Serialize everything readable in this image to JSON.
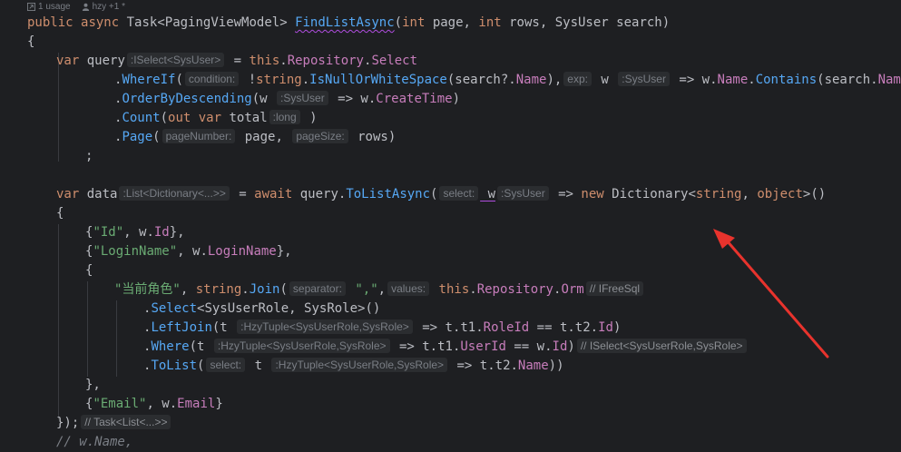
{
  "meta": {
    "usages": "1 usage",
    "author": "hzy +1 *"
  },
  "code": {
    "l01": {
      "kw1": "public",
      "kw2": "async",
      "t1": "Task",
      "t2": "<",
      "t3": "PagingViewModel",
      "t4": ">",
      "fn": "FindListAsync",
      "p1": "(",
      "kw3": "int",
      "p2": " page, ",
      "kw4": "int",
      "p3": " rows, ",
      "t5": "SysUser",
      "p4": " search)"
    },
    "l02": "{",
    "l03": {
      "kw": "var",
      "v": " query",
      "h": ":ISelect<SysUser>",
      "eq": " = ",
      "kw2": "this",
      "d": ".",
      "pr": "Repository",
      "d2": ".",
      "pr2": "Select"
    },
    "l04": {
      "d": ".",
      "fn": "WhereIf",
      "p": "(",
      "h": "condition:",
      "neg": " !",
      "kw": "string",
      "d2": ".",
      "fn2": "IsNullOrWhiteSpace",
      "rest": "(search?.",
      "pr": "Name",
      "rest2": "),",
      "h2": "exp:",
      "w": " w ",
      "h3": ":SysUser",
      "arrow": " => w.",
      "pr2": "Name",
      "d3": ".",
      "fn3": "Contains",
      "rest3": "(search.",
      "pr3": "Name",
      "rest4": "))"
    },
    "l05": {
      "d": ".",
      "fn": "OrderByDescending",
      "p": "(w ",
      "h": ":SysUser",
      "arrow": " => w.",
      "pr": "CreateTime",
      "end": ")"
    },
    "l06": {
      "d": ".",
      "fn": "Count",
      "p": "(",
      "kw": "out",
      "kw2": " var",
      "v": " total",
      "h": ":long",
      "end": " )"
    },
    "l07": {
      "d": ".",
      "fn": "Page",
      "p": "(",
      "h": "pageNumber:",
      "a": " page, ",
      "h2": "pageSize:",
      "b": " rows)"
    },
    "l08": ";",
    "l10": {
      "kw": "var",
      "v": " data",
      "h": ":List<Dictionary<...>>",
      "eq": " = ",
      "kw2": "await",
      "q": " query.",
      "fn": "ToListAsync",
      "p": "(",
      "h2": "select:",
      "w": " w",
      "h3": ":SysUser",
      "arrow": " => ",
      "kw3": "new",
      "cls": " Dictionary",
      "gen": "<",
      "kw4": "string",
      "c": ", ",
      "kw5": "object",
      "gen2": ">()"
    },
    "l11": "{",
    "l12": {
      "b": "{",
      "s": "\"Id\"",
      "r": ", w.",
      "pr": "Id",
      "e": "},"
    },
    "l13": {
      "b": "{",
      "s": "\"LoginName\"",
      "r": ", w.",
      "pr": "LoginName",
      "e": "},"
    },
    "l14": "{",
    "l15": {
      "s": "\"当前角色\"",
      "c": ", ",
      "kw": "string",
      "d": ".",
      "fn": "Join",
      "p": "(",
      "h": "separator:",
      "s2": " \",\"",
      "c2": ",",
      "h2": "values:",
      "kw2": " this",
      "d2": ".",
      "pr": "Repository",
      "d3": ".",
      "pr2": "Orm",
      "h3": "// IFreeSql"
    },
    "l16": {
      "d": ".",
      "fn": "Select",
      "g": "<",
      "t1": "SysUserRole",
      "c": ", ",
      "t2": "SysRole",
      "e": ">()"
    },
    "l17": {
      "d": ".",
      "fn": "LeftJoin",
      "p": "(t ",
      "h": ":HzyTuple<SysUserRole,SysRole>",
      "a": " => t.t1.",
      "pr": "RoleId",
      "m": " == t.t2.",
      "pr2": "Id",
      "e": ")"
    },
    "l18": {
      "d": ".",
      "fn": "Where",
      "p": "(t ",
      "h": ":HzyTuple<SysUserRole,SysRole>",
      "a": " => t.t1.",
      "pr": "UserId",
      "m": " == w.",
      "pr2": "Id",
      "e": ")",
      "h2": "// ISelect<SysUserRole,SysRole>"
    },
    "l19": {
      "d": ".",
      "fn": "ToList",
      "p": "(",
      "h": "select:",
      "t": " t ",
      "h2": ":HzyTuple<SysUserRole,SysRole>",
      "a": " => t.t2.",
      "pr": "Name",
      "e": "))"
    },
    "l20": "},",
    "l21": {
      "b": "{",
      "s": "\"Email\"",
      "r": ", w.",
      "pr": "Email",
      "e": "}"
    },
    "l22": {
      "t": "});",
      "h": "// Task<List<...>>"
    },
    "l23": "// w.Name,"
  },
  "colors": {
    "background": "#1e1f22",
    "annotation_arrow": "#e8332d"
  }
}
